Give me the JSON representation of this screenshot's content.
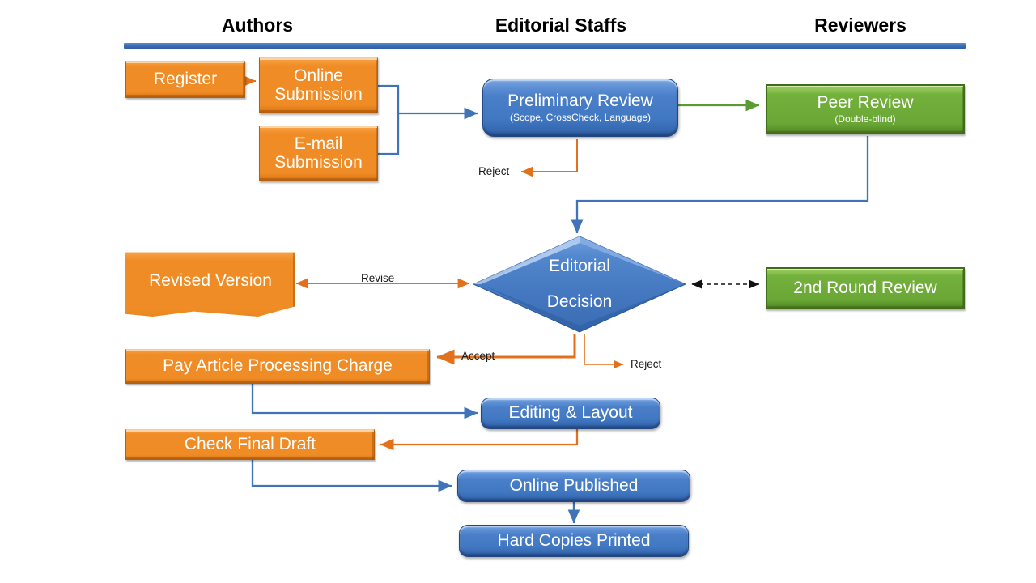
{
  "title": "Journal Editorial Workflow Flowchart",
  "columns": [
    {
      "label": "Authors"
    },
    {
      "label": "Editorial Staffs"
    },
    {
      "label": "Reviewers"
    }
  ],
  "colors": {
    "orange": "#F08C26",
    "green": "#6AA736",
    "blue": "#4178C2",
    "divider": "#3F6FB5",
    "orange_arrow": "#E3711C",
    "blue_arrow": "#4178C2",
    "green_arrow": "#5A9B35",
    "black_arrow": "#000000"
  },
  "nodes": [
    {
      "id": "register",
      "label": "Register",
      "sub": "",
      "shape": "orange-rect"
    },
    {
      "id": "online_sub",
      "label": "Online\nSubmission",
      "sub": "",
      "shape": "orange-rect"
    },
    {
      "id": "email_sub",
      "label": "E-mail\nSubmission",
      "sub": "",
      "shape": "orange-rect"
    },
    {
      "id": "prelim_review",
      "label": "Preliminary Review",
      "sub": "(Scope, CrossCheck, Language)",
      "shape": "blue-round"
    },
    {
      "id": "peer_review",
      "label": "Peer Review",
      "sub": "(Double-blind)",
      "shape": "green-rect"
    },
    {
      "id": "editorial_decision",
      "label": "Editorial\nDecision",
      "sub": "",
      "shape": "diamond"
    },
    {
      "id": "revised_version",
      "label": "Revised Version",
      "sub": "",
      "shape": "orange-doc"
    },
    {
      "id": "second_round",
      "label": "2nd Round Review",
      "sub": "",
      "shape": "green-rect"
    },
    {
      "id": "pay_apc",
      "label": "Pay Article Processing Charge",
      "sub": "",
      "shape": "orange-rect"
    },
    {
      "id": "editing_layout",
      "label": "Editing & Layout",
      "sub": "",
      "shape": "blue-round"
    },
    {
      "id": "check_draft",
      "label": "Check Final Draft",
      "sub": "",
      "shape": "orange-rect"
    },
    {
      "id": "online_pub",
      "label": "Online Published",
      "sub": "",
      "shape": "blue-round"
    },
    {
      "id": "hard_copies",
      "label": "Hard Copies Printed",
      "sub": "",
      "shape": "blue-round"
    }
  ],
  "node_text": {
    "register": "Register",
    "online_sub_l1": "Online",
    "online_sub_l2": "Submission",
    "email_sub_l1": "E-mail",
    "email_sub_l2": "Submission",
    "prelim_main": "Preliminary Review",
    "prelim_sub": "(Scope, CrossCheck, Language)",
    "peer_main": "Peer Review",
    "peer_sub": "(Double-blind)",
    "decision_l1": "Editorial",
    "decision_l2": "Decision",
    "revised_version": "Revised Version",
    "second_round": "2nd Round Review",
    "pay_apc": "Pay Article Processing Charge",
    "editing_layout": "Editing & Layout",
    "check_draft": "Check Final Draft",
    "online_pub": "Online Published",
    "hard_copies": "Hard Copies Printed"
  },
  "edge_labels": {
    "reject_prelim": "Reject",
    "revise": "Revise",
    "accept": "Accept",
    "reject_decision": "Reject"
  },
  "chart_data": {
    "type": "diagram",
    "title": "Journal Editorial Workflow Flowchart",
    "swimlanes": [
      "Authors",
      "Editorial Staffs",
      "Reviewers"
    ],
    "nodes": [
      {
        "id": "register",
        "label": "Register",
        "lane": "Authors",
        "shape": "rect",
        "color": "orange"
      },
      {
        "id": "online_sub",
        "label": "Online Submission",
        "lane": "Authors",
        "shape": "rect",
        "color": "orange"
      },
      {
        "id": "email_sub",
        "label": "E-mail Submission",
        "lane": "Authors",
        "shape": "rect",
        "color": "orange"
      },
      {
        "id": "prelim_review",
        "label": "Preliminary Review (Scope, CrossCheck, Language)",
        "lane": "Editorial Staffs",
        "shape": "rounded-rect",
        "color": "blue"
      },
      {
        "id": "peer_review",
        "label": "Peer Review (Double-blind)",
        "lane": "Reviewers",
        "shape": "rect",
        "color": "green"
      },
      {
        "id": "editorial_decision",
        "label": "Editorial Decision",
        "lane": "Editorial Staffs",
        "shape": "diamond",
        "color": "blue"
      },
      {
        "id": "revised_version",
        "label": "Revised Version",
        "lane": "Authors",
        "shape": "document",
        "color": "orange"
      },
      {
        "id": "second_round",
        "label": "2nd Round Review",
        "lane": "Reviewers",
        "shape": "rect",
        "color": "green"
      },
      {
        "id": "pay_apc",
        "label": "Pay Article Processing Charge",
        "lane": "Authors",
        "shape": "rect",
        "color": "orange"
      },
      {
        "id": "editing_layout",
        "label": "Editing & Layout",
        "lane": "Editorial Staffs",
        "shape": "rounded-rect",
        "color": "blue"
      },
      {
        "id": "check_draft",
        "label": "Check Final Draft",
        "lane": "Authors",
        "shape": "rect",
        "color": "orange"
      },
      {
        "id": "online_pub",
        "label": "Online Published",
        "lane": "Editorial Staffs",
        "shape": "rounded-rect",
        "color": "blue"
      },
      {
        "id": "hard_copies",
        "label": "Hard Copies Printed",
        "lane": "Editorial Staffs",
        "shape": "rounded-rect",
        "color": "blue"
      }
    ],
    "edges": [
      {
        "from": "register",
        "to": "online_sub",
        "label": "",
        "style": "solid",
        "color": "orange"
      },
      {
        "from": "online_sub",
        "to": "prelim_review",
        "label": "",
        "style": "solid",
        "color": "blue"
      },
      {
        "from": "email_sub",
        "to": "prelim_review",
        "label": "",
        "style": "solid",
        "color": "blue"
      },
      {
        "from": "prelim_review",
        "to": "peer_review",
        "label": "",
        "style": "solid",
        "color": "green"
      },
      {
        "from": "prelim_review",
        "to": "reject",
        "label": "Reject",
        "style": "solid",
        "color": "orange"
      },
      {
        "from": "peer_review",
        "to": "editorial_decision",
        "label": "",
        "style": "solid",
        "color": "blue"
      },
      {
        "from": "editorial_decision",
        "to": "revised_version",
        "label": "Revise",
        "style": "solid-bidirectional",
        "color": "orange"
      },
      {
        "from": "editorial_decision",
        "to": "second_round",
        "label": "",
        "style": "dashed-bidirectional",
        "color": "black"
      },
      {
        "from": "editorial_decision",
        "to": "pay_apc",
        "label": "Accept",
        "style": "solid",
        "color": "orange"
      },
      {
        "from": "editorial_decision",
        "to": "reject",
        "label": "Reject",
        "style": "solid",
        "color": "orange"
      },
      {
        "from": "pay_apc",
        "to": "editing_layout",
        "label": "",
        "style": "solid",
        "color": "blue"
      },
      {
        "from": "editing_layout",
        "to": "check_draft",
        "label": "",
        "style": "solid",
        "color": "orange"
      },
      {
        "from": "check_draft",
        "to": "online_pub",
        "label": "",
        "style": "solid",
        "color": "blue"
      },
      {
        "from": "online_pub",
        "to": "hard_copies",
        "label": "",
        "style": "solid",
        "color": "blue"
      }
    ]
  }
}
